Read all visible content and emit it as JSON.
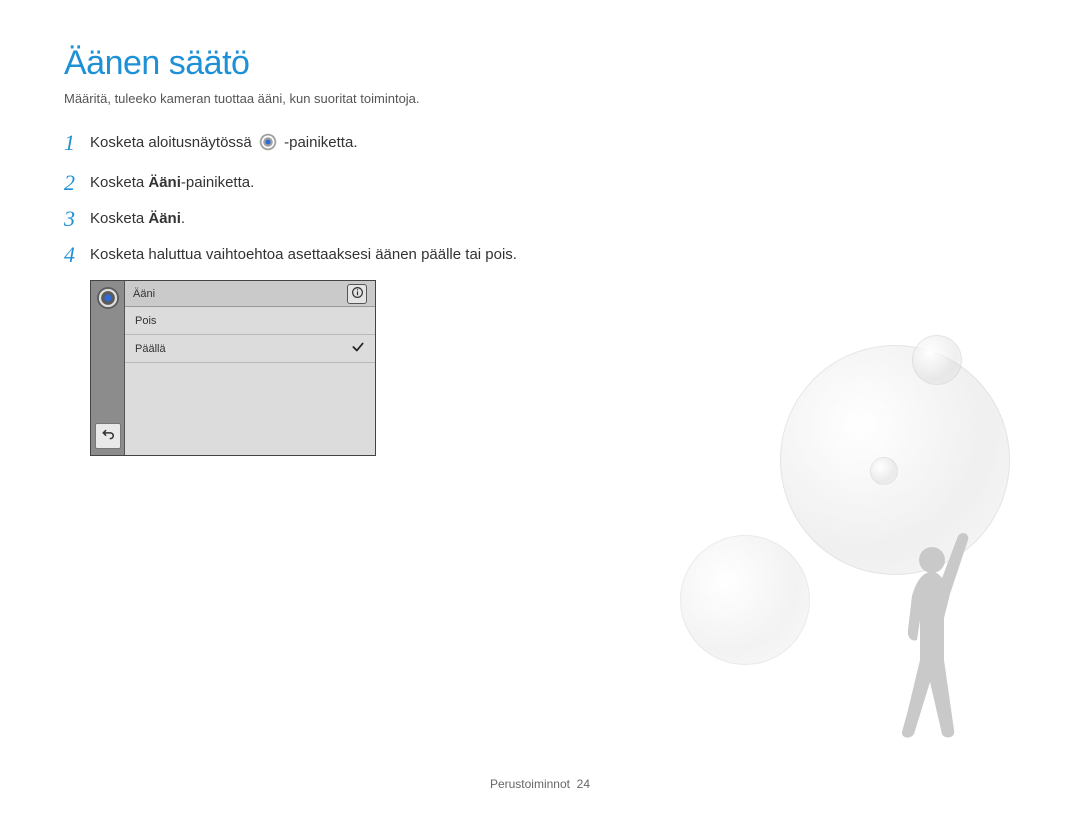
{
  "title": "Äänen säätö",
  "subtitle": "Määritä, tuleeko kameran tuottaa ääni, kun suoritat toimintoja.",
  "steps": {
    "s1_pre": "Kosketa aloitusnäytössä ",
    "s1_post": "-painiketta.",
    "s2_pre": "Kosketa ",
    "s2_bold": "Ääni",
    "s2_post": "-painiketta.",
    "s3_pre": "Kosketa ",
    "s3_bold": "Ääni",
    "s3_post": ".",
    "s4": "Kosketa haluttua vaihtoehtoa asettaaksesi äänen päälle tai pois."
  },
  "nums": {
    "n1": "1",
    "n2": "2",
    "n3": "3",
    "n4": "4"
  },
  "screenshot": {
    "header": "Ääni",
    "rows": {
      "off": "Pois",
      "on": "Päällä"
    }
  },
  "footer": {
    "section": "Perustoiminnot",
    "page": "24"
  }
}
